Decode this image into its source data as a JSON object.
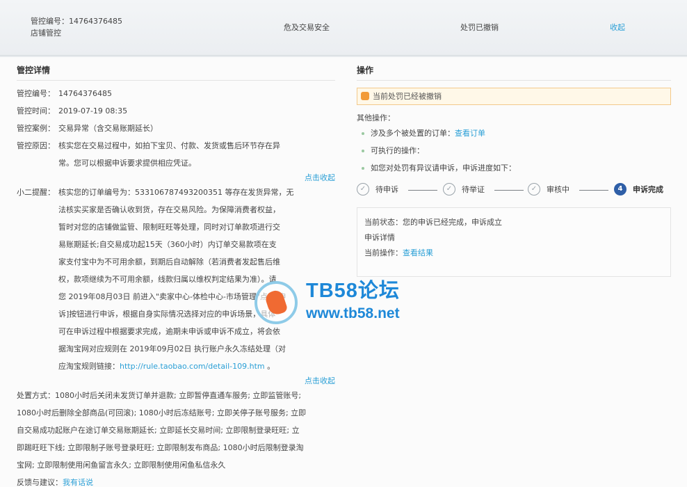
{
  "topbar": {
    "control_id": "管控编号：14764376485",
    "control_type": "店铺管控",
    "category": "危及交易安全",
    "status": "处罚已撤销",
    "collapse_label": "收起"
  },
  "detail": {
    "title": "管控详情",
    "fields": [
      {
        "label": "管控编号：",
        "value": "14764376485"
      },
      {
        "label": "管控时间：",
        "value": "2019-07-19 08:35"
      },
      {
        "label": "管控案例：",
        "value": "交易异常（含交易账期延长）"
      }
    ],
    "reason": {
      "label": "管控原因：",
      "line1": "核实您在交易过程中，如拍下宝贝、付款、发货或售后环节存在异",
      "line2": "常。您可以根据申诉要求提供相应凭证。"
    },
    "collapse_link_1": "点击收起",
    "tip": {
      "label": "小二提醒：",
      "line1": "核实您的订单编号为：533106787493200351 等存在发货异常，无",
      "lines": [
        "法核实买家是否确认收到货，存在交易风险。为保障消费者权益，",
        "暂时对您的店铺做监管、限制旺旺等处理，同时对订单款项进行交",
        "易账期延长;自交易成功起15天（360小时）内订单交易款项在支",
        "家支付宝中为不可用余额，到期后自动解除（若消费者发起售后维",
        "权，款项继续为不可用余额，线款归属以维权判定结果为准）。请",
        "您 2019年08月03日 前进入\"卖家中心-体检中心-市场管理\"点击[申",
        "诉]按钮进行申诉，根据自身实际情况选择对应的申诉场景，具体",
        "可在申诉过程中根据要求完成，逾期未申诉或申诉不成立，将会依",
        "据淘宝网对应规则在 2019年09月02日 执行账户永久冻结处理（对"
      ],
      "rule_prefix": "应淘宝规则链接：",
      "rule_link": "http://rule.taobao.com/detail-109.htm",
      "rule_suffix": " 。"
    },
    "collapse_link_2": "点击收起",
    "measures": [
      "处置方式：1080小时后关闭未发货订单并退款; 立即暂停直通车服务; 立即监管账号;",
      "1080小时后删除全部商品(可回滚); 1080小时后冻结账号; 立即关停子账号服务; 立即",
      "自交易成功起账户在途订单交易账期延长; 立即延长交易时间; 立即限制登录旺旺; 立",
      "即踢旺旺下线; 立即限制子账号登录旺旺; 立即限制发布商品; 1080小时后限制登录淘",
      "宝网; 立即限制使用闲鱼留言永久; 立即限制使用闲鱼私信永久"
    ],
    "feedback_label": "反馈与建议：",
    "feedback_link": "我有话说"
  },
  "operation": {
    "title": "操作",
    "notice": "当前处罚已经被撤销",
    "other_title": "其他操作：",
    "bullet1_text": "涉及多个被处置的订单：",
    "bullet1_link": "查看订单",
    "bullet2": "可执行的操作：",
    "bullet3": "如您对处罚有异议请申诉，申诉进度如下：",
    "steps": [
      {
        "label": "待申诉",
        "mark": "✓"
      },
      {
        "label": "待举证",
        "mark": "✓"
      },
      {
        "label": "审核中",
        "mark": "✓"
      },
      {
        "label": "申诉完成",
        "mark": "4"
      }
    ],
    "result": {
      "status_line": "当前状态：您的申诉已经完成，申诉成立",
      "detail_line": "申诉详情",
      "op_prefix": "当前操作：",
      "op_link": "查看结果"
    }
  },
  "watermark": {
    "title": "TB58论坛",
    "url": "www.tb58.net"
  },
  "colors": {
    "link": "#2a9fd6",
    "step_active": "#2f5fa7",
    "notice_border": "#f3c98a",
    "watermark": "#1e88d8"
  }
}
